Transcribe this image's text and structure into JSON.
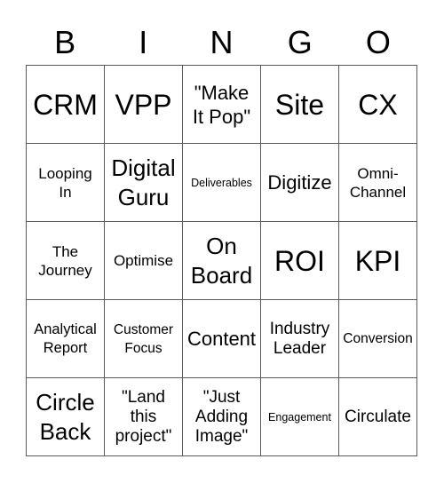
{
  "header": {
    "letters": [
      "B",
      "I",
      "N",
      "G",
      "O"
    ]
  },
  "grid": {
    "rows": [
      [
        {
          "text": "CRM",
          "size": "xl"
        },
        {
          "text": "VPP",
          "size": "xl"
        },
        {
          "text": "\"Make\nIt Pop\"",
          "size": "m"
        },
        {
          "text": "Site",
          "size": "xl"
        },
        {
          "text": "CX",
          "size": "xl"
        }
      ],
      [
        {
          "text": "Looping\nIn",
          "size": "s"
        },
        {
          "text": "Digital\nGuru",
          "size": "l"
        },
        {
          "text": "Deliverables",
          "size": "xxs"
        },
        {
          "text": "Digitize",
          "size": "m"
        },
        {
          "text": "Omni-\nChannel",
          "size": "s"
        }
      ],
      [
        {
          "text": "The\nJourney",
          "size": "s"
        },
        {
          "text": "Optimise",
          "size": "s"
        },
        {
          "text": "On\nBoard",
          "size": "l"
        },
        {
          "text": "ROI",
          "size": "xl"
        },
        {
          "text": "KPI",
          "size": "xl"
        }
      ],
      [
        {
          "text": "Analytical\nReport",
          "size": "xs-l"
        },
        {
          "text": "Customer\nFocus",
          "size": "xs"
        },
        {
          "text": "Content",
          "size": "m"
        },
        {
          "text": "Industry\nLeader",
          "size": "ms"
        },
        {
          "text": "Conversion",
          "size": "xs"
        }
      ],
      [
        {
          "text": "Circle\nBack",
          "size": "l"
        },
        {
          "text": "\"Land\nthis\nproject\"",
          "size": "ms"
        },
        {
          "text": "\"Just\nAdding\nImage\"",
          "size": "ms"
        },
        {
          "text": "Engagement",
          "size": "xxs"
        },
        {
          "text": "Circulate",
          "size": "ms"
        }
      ]
    ]
  }
}
